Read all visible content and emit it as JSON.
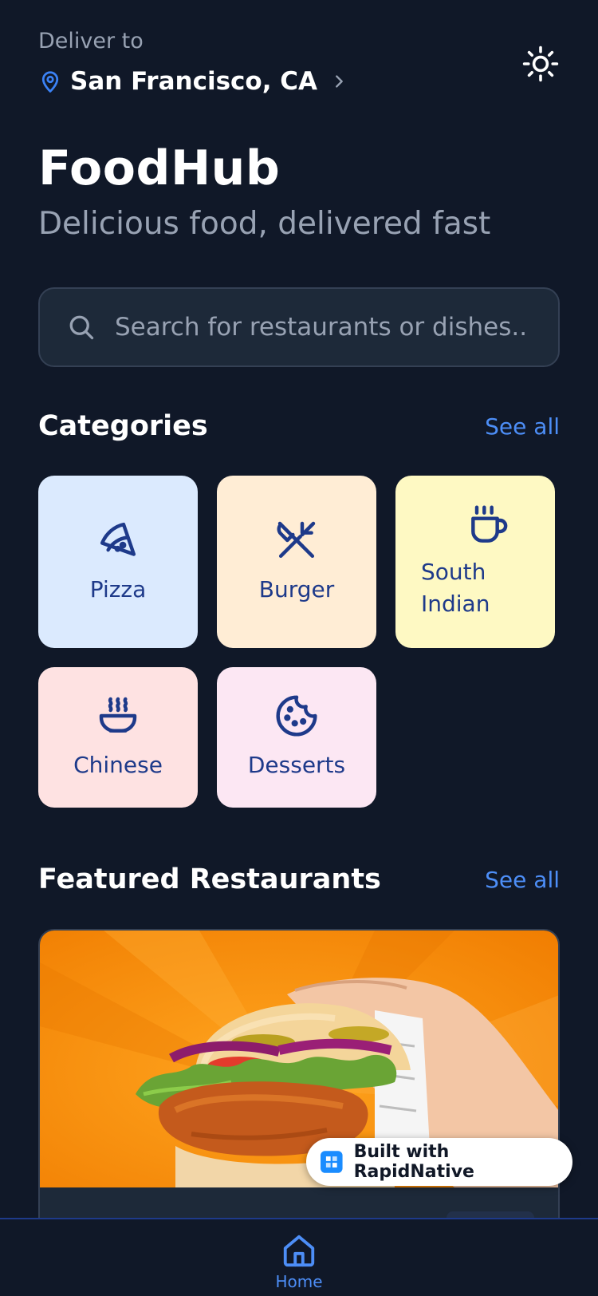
{
  "header": {
    "deliver_label": "Deliver to",
    "location": "San Francisco, CA",
    "app_title": "FoodHub",
    "app_subtitle": "Delicious food, delivered fast"
  },
  "search": {
    "placeholder": "Search for restaurants or dishes..."
  },
  "categories": {
    "title": "Categories",
    "see_all": "See all",
    "items": [
      {
        "label": "Pizza",
        "icon": "pizza-icon",
        "bg": "#dbeafe"
      },
      {
        "label": "Burger",
        "icon": "utensils-icon",
        "bg": "#ffedd5"
      },
      {
        "label": "South Indian",
        "icon": "coffee-cup-icon",
        "bg": "#fef9c3"
      },
      {
        "label": "Chinese",
        "icon": "soup-bowl-icon",
        "bg": "#fee2e2"
      },
      {
        "label": "Desserts",
        "icon": "cookie-icon",
        "bg": "#fce7f3"
      }
    ]
  },
  "featured": {
    "title": "Featured Restaurants",
    "see_all": "See all"
  },
  "badge": {
    "label": "Built with RapidNative"
  },
  "tabbar": {
    "home_label": "Home"
  },
  "colors": {
    "background": "#101828",
    "accent": "#4d8ef7",
    "category_text": "#1e3a8a"
  }
}
